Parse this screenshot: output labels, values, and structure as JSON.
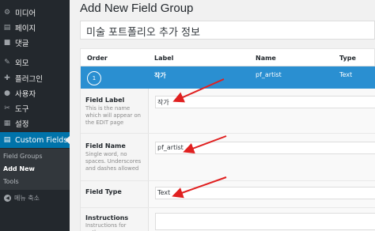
{
  "sidebar": {
    "items": [
      {
        "icon": "media-icon",
        "glyph": "⚙",
        "label": "미디어"
      },
      {
        "icon": "pages-icon",
        "glyph": "▤",
        "label": "페이지"
      },
      {
        "icon": "comments-icon",
        "glyph": "■",
        "label": "댓글"
      },
      {
        "icon": "appearance-icon",
        "glyph": "✎",
        "label": "외모"
      },
      {
        "icon": "plugins-icon",
        "glyph": "✚",
        "label": "플러그인"
      },
      {
        "icon": "users-icon",
        "glyph": "●",
        "label": "사용자"
      },
      {
        "icon": "tools-icon",
        "glyph": "✂",
        "label": "도구"
      },
      {
        "icon": "settings-icon",
        "glyph": "▦",
        "label": "설정"
      },
      {
        "icon": "custom-fields-icon",
        "glyph": "▤",
        "label": "Custom Fields"
      }
    ],
    "submenu": [
      "Field Groups",
      "Add New",
      "Tools"
    ],
    "collapse_label": "메뉴 축소",
    "colors": {
      "bg": "#23282d",
      "active": "#0073aa"
    }
  },
  "main": {
    "title": "Add New Field Group",
    "group_title_value": "미술 포트폴리오 추가 정보",
    "table": {
      "headers": [
        "Order",
        "Label",
        "Name",
        "Type"
      ],
      "row": {
        "order": "1",
        "label": "작가",
        "name": "pf_artist",
        "type": "Text"
      }
    },
    "settings": [
      {
        "label": "Field Label",
        "description": "This is the name which will appear on the EDIT page",
        "value": "작가"
      },
      {
        "label": "Field Name",
        "description": "Single word, no spaces. Underscores and dashes allowed",
        "value": "pf_artist"
      },
      {
        "label": "Field Type",
        "description": "",
        "value": "Text"
      },
      {
        "label": "Instructions",
        "description": "Instructions for authors.",
        "value": ""
      }
    ],
    "colors": {
      "row_highlight": "#2a8fd1",
      "arrow": "#e02020"
    }
  }
}
